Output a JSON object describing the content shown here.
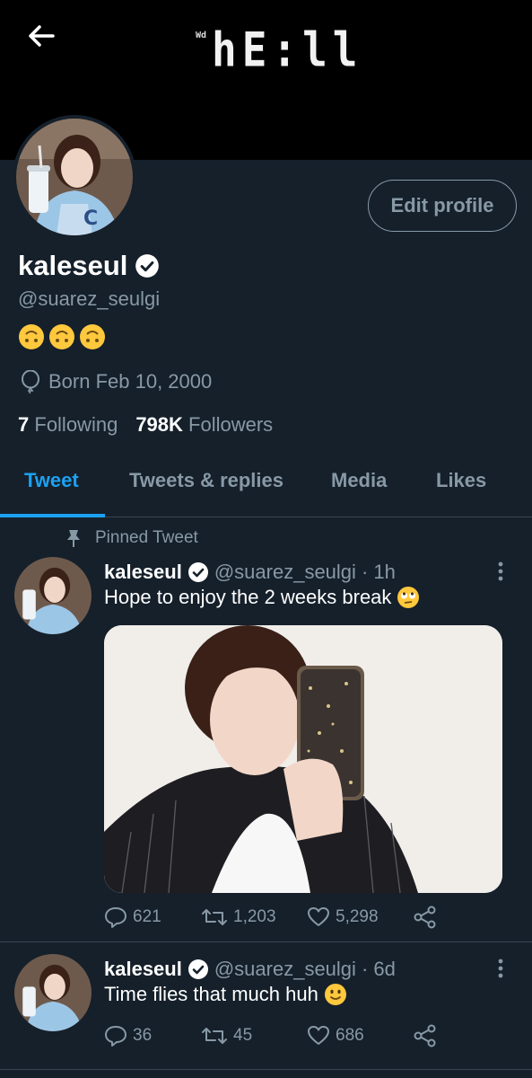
{
  "header": {
    "banner_big": "hE:ll",
    "banner_small": "Wd"
  },
  "profile": {
    "display_name": "kaleseul",
    "handle": "@suarez_seulgi",
    "bio_emojis": [
      "upside-down-face",
      "upside-down-face",
      "upside-down-face"
    ],
    "born": "Born Feb 10, 2000",
    "following_count": "7",
    "following_label": "Following",
    "followers_count": "798K",
    "followers_label": "Followers",
    "edit_label": "Edit profile"
  },
  "tabs": [
    {
      "label": "Tweet",
      "active": true
    },
    {
      "label": "Tweets & replies",
      "active": false
    },
    {
      "label": "Media",
      "active": false
    },
    {
      "label": "Likes",
      "active": false
    }
  ],
  "pinned_label": "Pinned Tweet",
  "tweets": [
    {
      "name": "kaleseul",
      "handle": "@suarez_seulgi",
      "time": "· 1h",
      "text": "Hope to enjoy the 2 weeks break",
      "emoji": "rolling-eyes",
      "replies": "621",
      "retweets": "1,203",
      "likes": "5,298"
    },
    {
      "name": "kaleseul",
      "handle": "@suarez_seulgi",
      "time": "· 6d",
      "text": "Time flies that much huh",
      "emoji": "slightly-smiling-face",
      "replies": "36",
      "retweets": "45",
      "likes": "686"
    }
  ],
  "colors": {
    "background": "#15202b",
    "accent": "#1da1f2",
    "muted": "#8899a6",
    "divider": "#38444d"
  }
}
